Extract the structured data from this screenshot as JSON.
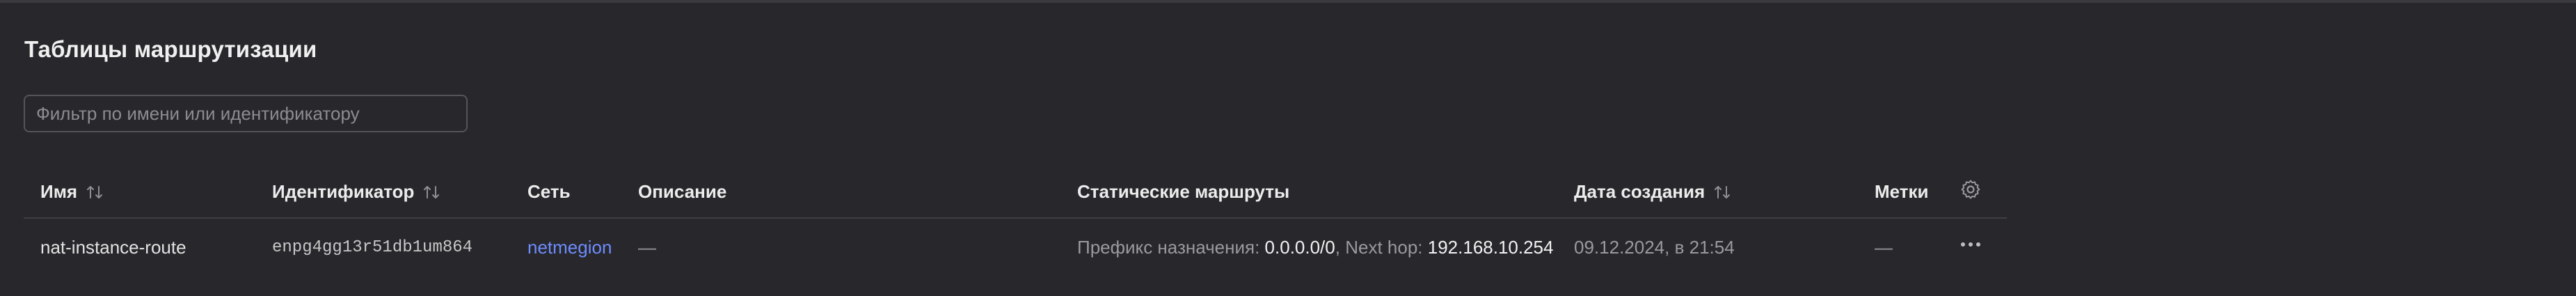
{
  "page": {
    "title": "Таблицы маршрутизации"
  },
  "filter": {
    "placeholder": "Фильтр по имени или идентификатору",
    "value": ""
  },
  "table": {
    "columns": {
      "name": "Имя",
      "id": "Идентификатор",
      "network": "Сеть",
      "description": "Описание",
      "static_routes": "Статические маршруты",
      "created": "Дата создания",
      "labels": "Метки"
    },
    "rows": [
      {
        "name": "nat-instance-route",
        "id": "enpg4gg13r51db1um864",
        "network": "netmegion",
        "description": "—",
        "route_prefix_label": "Префикс назначения:",
        "route_prefix_value": "0.0.0.0/0",
        "route_sep": ",",
        "route_nexthop_label": "Next hop:",
        "route_nexthop_value": "192.168.10.254",
        "created": "09.12.2024, в 21:54",
        "labels": "—"
      }
    ]
  },
  "icons": {
    "sort": "sort-arrows-icon",
    "settings": "gear-icon",
    "more": "more-horizontal-icon"
  }
}
